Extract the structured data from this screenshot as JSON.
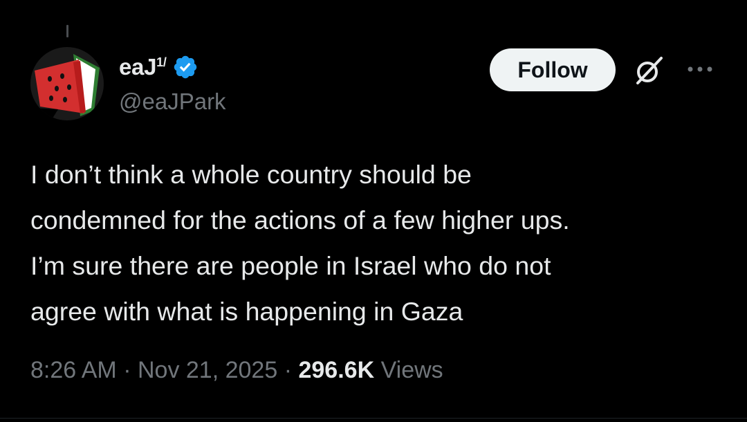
{
  "post": {
    "author": {
      "display_name": "eaJ",
      "name_suffix": "1/",
      "handle": "@eaJPark",
      "verified": true,
      "verified_color": "#1d9bf0",
      "avatar_icon": "watermelon-avatar"
    },
    "follow_label": "Follow",
    "text": "I don’t think a whole country should be\ncondemned for the actions of a few higher ups.\nI’m sure there are people in Israel who do not\nagree with what is happening in Gaza",
    "meta": {
      "time": "8:26 AM",
      "separator": "·",
      "date": "Nov 21, 2025",
      "views_count": "296.6K",
      "views_label": "Views"
    }
  },
  "icons": {
    "verified": "verified-badge-icon",
    "grok": "grok-icon",
    "more": "more-options-icon"
  },
  "colors": {
    "background": "#000000",
    "primary_text": "#e7e9ea",
    "secondary_text": "#71767b",
    "follow_button_bg": "#eff3f4",
    "follow_button_text": "#0f1419"
  }
}
